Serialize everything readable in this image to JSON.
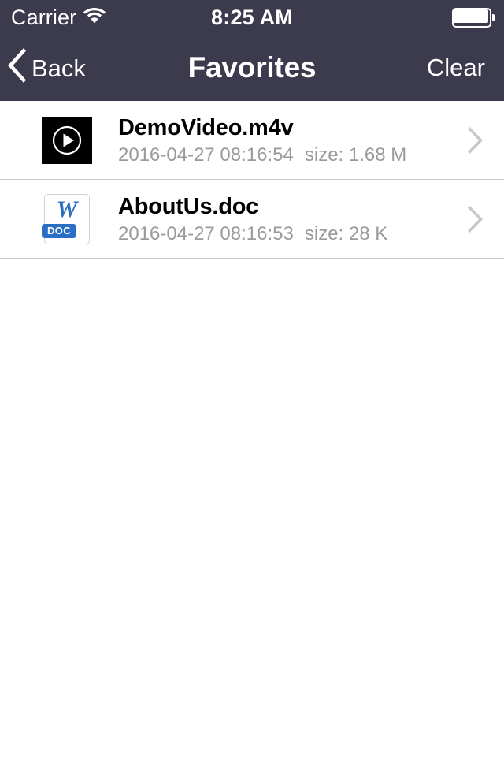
{
  "status_bar": {
    "carrier": "Carrier",
    "wifi_icon": "wifi-icon",
    "time": "8:25 AM",
    "battery_icon": "battery-full-icon"
  },
  "nav_bar": {
    "back_icon": "chevron-left-icon",
    "back_label": "Back",
    "title": "Favorites",
    "clear_label": "Clear",
    "background_color": "#3c3b4e",
    "text_color": "#ffffff"
  },
  "list": {
    "separator_color": "#c8c7cc",
    "disclosure_icon": "chevron-right-icon",
    "items": [
      {
        "name": "DemoVideo.m4v",
        "date": "2016-04-27 08:16:54",
        "size": "size: 1.68 M",
        "icon": "video-play-icon",
        "icon_type": "video"
      },
      {
        "name": "AboutUs.doc",
        "date": "2016-04-27 08:16:53",
        "size": "size: 28 K",
        "icon": "word-document-icon",
        "icon_type": "doc",
        "doc_letter": "W",
        "doc_badge": "DOC",
        "doc_color": "#2a6ec6"
      }
    ]
  }
}
